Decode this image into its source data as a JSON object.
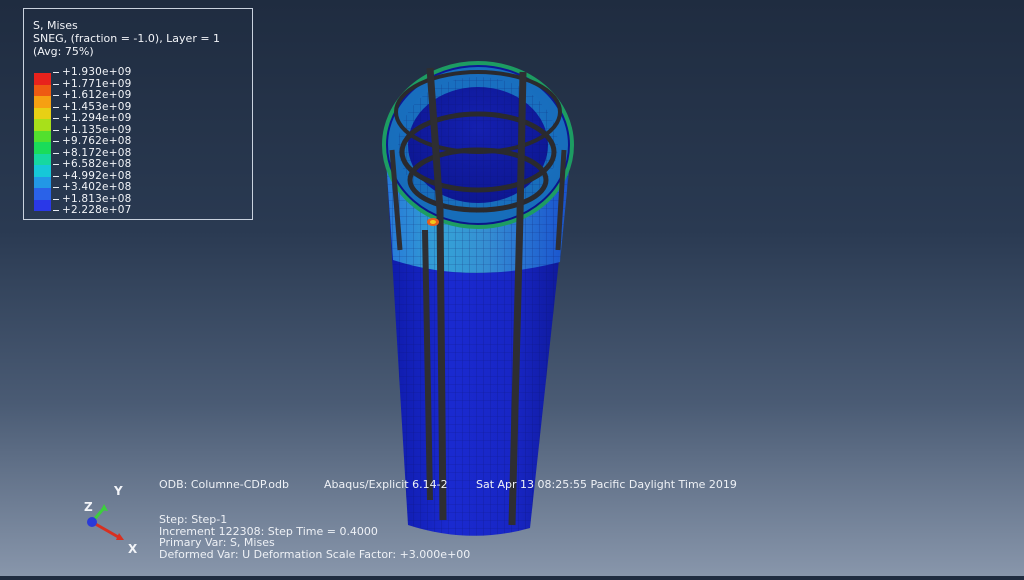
{
  "legend": {
    "title": "S, Mises",
    "subtitle": "SNEG, (fraction = -1.0), Layer = 1",
    "averaging": "(Avg: 75%)",
    "values": [
      "+1.930e+09",
      "+1.771e+09",
      "+1.612e+09",
      "+1.453e+09",
      "+1.294e+09",
      "+1.135e+09",
      "+9.762e+08",
      "+8.172e+08",
      "+6.582e+08",
      "+4.992e+08",
      "+3.402e+08",
      "+1.813e+08",
      "+2.228e+07"
    ],
    "colors": [
      "#e8221c",
      "#ee5a12",
      "#f6a012",
      "#e8d015",
      "#a8e01a",
      "#52e02e",
      "#1adc5a",
      "#16d8a0",
      "#16c8d8",
      "#2298e6",
      "#2a62e8",
      "#2a38e8",
      "#1a12d8"
    ]
  },
  "info": {
    "odb": "ODB: Columne-CDP.odb",
    "product": "Abaqus/Explicit 6.14-2",
    "date": "Sat Apr 13 08:25:55 Pacific Daylight Time 2019",
    "step": "Step: Step-1",
    "increment": "Increment    122308: Step Time =    0.4000",
    "primary_var": "Primary Var: S, Mises",
    "deformed_var": "Deformed Var: U   Deformation Scale Factor: +3.000e+00"
  },
  "triad": {
    "x": "X",
    "y": "Y",
    "z": "Z"
  }
}
